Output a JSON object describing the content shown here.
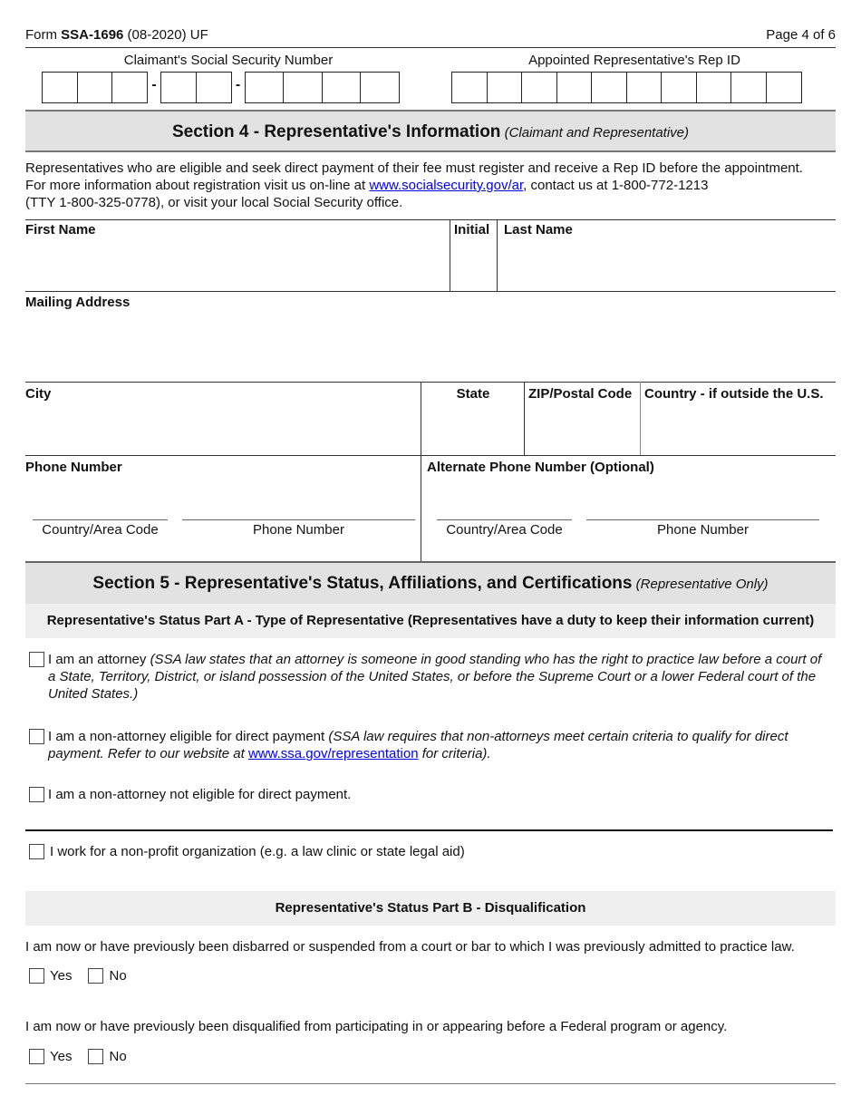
{
  "header": {
    "form_prefix": "Form ",
    "form_number": "SSA-1696",
    "form_suffix": " (08-2020) UF",
    "page": "Page 4 of 6"
  },
  "id_fields": {
    "ssn_label": "Claimant's Social Security Number",
    "ssn_separator": "-",
    "rep_id_label": "Appointed Representative's Rep ID"
  },
  "section4": {
    "title": "Section 4 - Representative's Information",
    "subtitle": "(Claimant and Representative)",
    "intro_line1": "Representatives who are eligible and seek direct payment of their fee must register and receive a Rep ID before the appointment.",
    "intro_line2_pre": "For more information about registration visit us on-line at ",
    "intro_link": "www.socialsecurity.gov/ar",
    "intro_line2_post": ", contact us at 1-800-772-1213",
    "intro_line3": "(TTY 1-800-325-0778), or visit your local Social Security office.",
    "fields": {
      "first_name": "First Name",
      "initial": "Initial",
      "last_name": "Last Name",
      "mailing_address": "Mailing Address",
      "city": "City",
      "state": "State",
      "zip": "ZIP/Postal Code",
      "country": "Country - if outside the U.S.",
      "phone": "Phone Number",
      "alt_phone": "Alternate Phone Number (Optional)",
      "country_area_code": "Country/Area Code",
      "phone_number_sub": "Phone Number"
    }
  },
  "section5": {
    "title": "Section 5 - Representative's Status, Affiliations, and Certifications",
    "subtitle": "(Representative Only)",
    "part_a": {
      "title": "Representative's Status Part A - Type of Representative (Representatives have a duty to keep their information current)",
      "options": [
        {
          "label": "I am an attorney ",
          "note": "(SSA law states that an attorney is someone in good standing who has the right to practice law before a court of a State, Territory, District, or island possession of the United States, or before the Supreme Court or a lower Federal court of the United States.)",
          "checked": false
        },
        {
          "label": "I am a non-attorney eligible for direct payment ",
          "note_pre": "(SSA law requires that non-attorneys meet certain criteria to qualify for direct payment. Refer to our website at ",
          "note_link": "www.ssa.gov/representation",
          "note_post": " for criteria).",
          "checked": false
        },
        {
          "label": "I am a non-attorney not eligible for direct payment.",
          "checked": false
        }
      ],
      "nonprofit": {
        "label": "I work for a non-profit organization (e.g. a law clinic or state legal aid)",
        "checked": false
      }
    },
    "part_b": {
      "title": "Representative's Status Part B - Disqualification",
      "questions": [
        {
          "text": "I am now or have previously been disbarred or suspended from a court or bar to which I was previously admitted to practice law.",
          "yes": "Yes",
          "no": "No"
        },
        {
          "text": "I am now or have previously been disqualified from participating in or appearing before a Federal program or agency.",
          "yes": "Yes",
          "no": "No"
        }
      ]
    }
  }
}
